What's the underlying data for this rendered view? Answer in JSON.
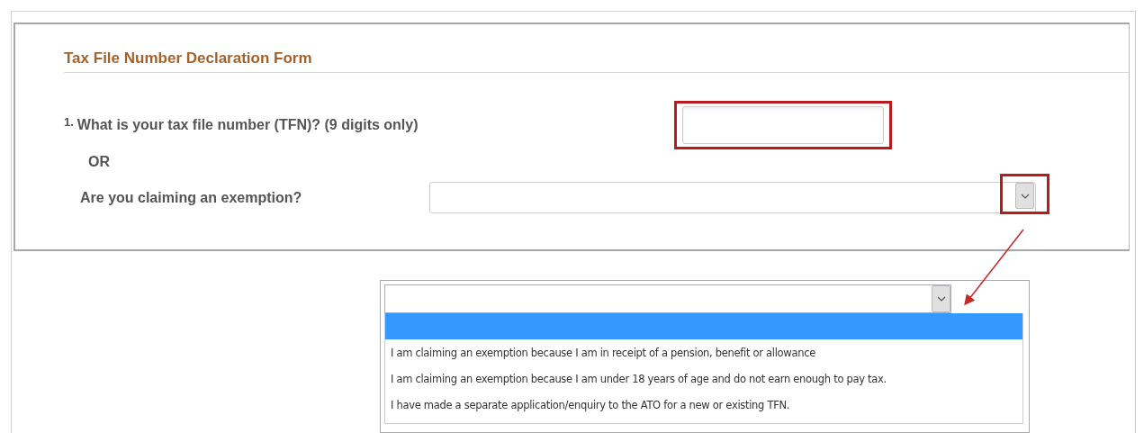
{
  "form": {
    "title": "Tax File Number Declaration Form",
    "question": {
      "number": "1.",
      "text": "What is your tax file number (TFN)? (9 digits only)",
      "field_highlighted": true
    },
    "or_label": "OR",
    "exemption": {
      "label": "Are you claiming an exemption?",
      "button_highlighted": true
    }
  },
  "callout": {
    "options": [
      {
        "selected": true
      },
      {
        "label": "I am claiming an exemption because I am in receipt of a pension, benefit or allowance",
        "selected": false
      },
      {
        "label": "I am claiming an exemption because I am under 18 years of age and do not earn enough to pay tax.",
        "selected": false
      },
      {
        "label": "I have made a separate application/enquiry to the ATO for a new or existing TFN.",
        "selected": false
      }
    ]
  }
}
